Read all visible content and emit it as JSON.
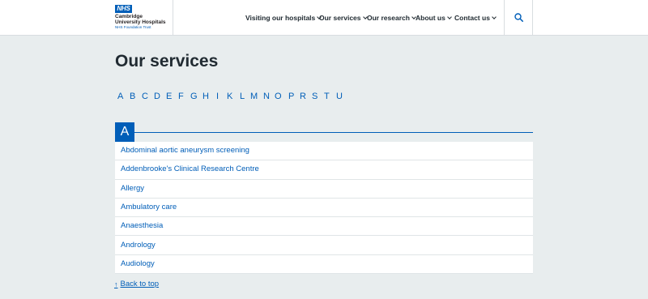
{
  "logo": {
    "badge": "NHS",
    "org_line1": "Cambridge",
    "org_line2": "University Hospitals",
    "org_line3": "NHS Foundation Trust"
  },
  "nav": {
    "items": [
      {
        "label": "Visiting our hospitals"
      },
      {
        "label": "Our services"
      },
      {
        "label": "Our research"
      },
      {
        "label": "About us"
      },
      {
        "label": "Contact us"
      }
    ]
  },
  "page": {
    "title": "Our services"
  },
  "alphabet": [
    "A",
    "B",
    "C",
    "D",
    "E",
    "F",
    "G",
    "H",
    "I",
    "K",
    "L",
    "M",
    "N",
    "O",
    "P",
    "R",
    "S",
    "T",
    "U"
  ],
  "section": {
    "letter": "A",
    "services": [
      "Abdominal aortic aneurysm screening",
      "Addenbrooke's Clinical Research Centre",
      "Allergy",
      "Ambulatory care",
      "Anaesthesia",
      "Andrology",
      "Audiology"
    ]
  },
  "back_to_top": {
    "icon": "up-arrow-icon",
    "label": "Back to top"
  },
  "colors": {
    "brand": "#005eb8",
    "background": "#e8edee"
  }
}
